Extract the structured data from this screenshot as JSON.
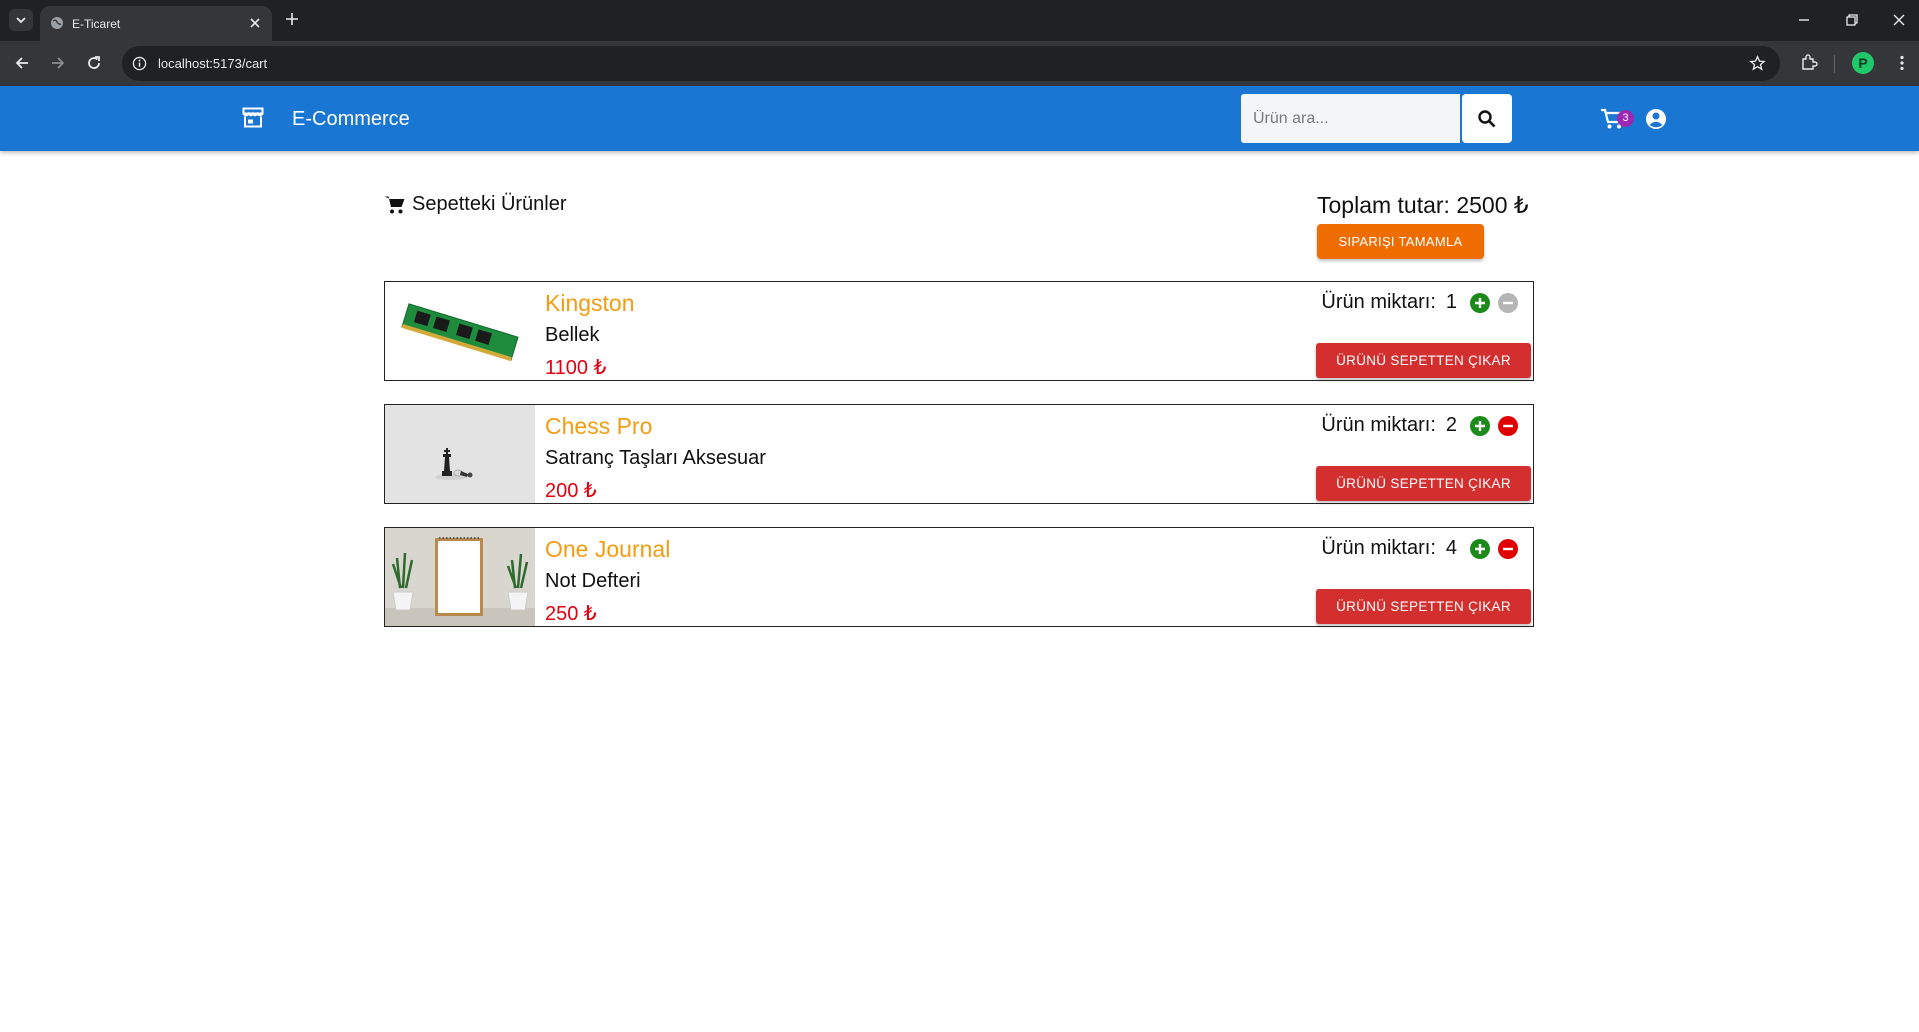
{
  "browser": {
    "tab_title": "E-Ticaret",
    "url": "localhost:5173/cart",
    "profile_initial": "P"
  },
  "header": {
    "brand": "E-Commerce",
    "search_placeholder": "Ürün ara...",
    "cart_count": "3"
  },
  "cart": {
    "title": "Sepetteki Ürünler",
    "total_label": "Toplam tutar: 2500 ₺",
    "checkout_label": "SIPARIŞI TAMAMLA",
    "qty_label": "Ürün miktarı:",
    "remove_label": "ÜRÜNÜ SEPETTEN ÇIKAR",
    "items": [
      {
        "name": "Kingston",
        "category": "Bellek",
        "price": "1100 ₺",
        "quantity": "1",
        "decrease_enabled": false
      },
      {
        "name": "Chess Pro",
        "category": "Satranç Taşları Aksesuar",
        "price": "200 ₺",
        "quantity": "2",
        "decrease_enabled": true
      },
      {
        "name": "One Journal",
        "category": "Not Defteri",
        "price": "250 ₺",
        "quantity": "4",
        "decrease_enabled": true
      }
    ]
  },
  "colors": {
    "appbar": "#1976d2",
    "checkout": "#ef6c00",
    "remove": "#d32f2f",
    "product_name": "#f39c12",
    "price": "#e3000f",
    "increase": "#1b8a1b",
    "decrease": "#e00000",
    "decrease_disabled": "#b5b5b5"
  }
}
